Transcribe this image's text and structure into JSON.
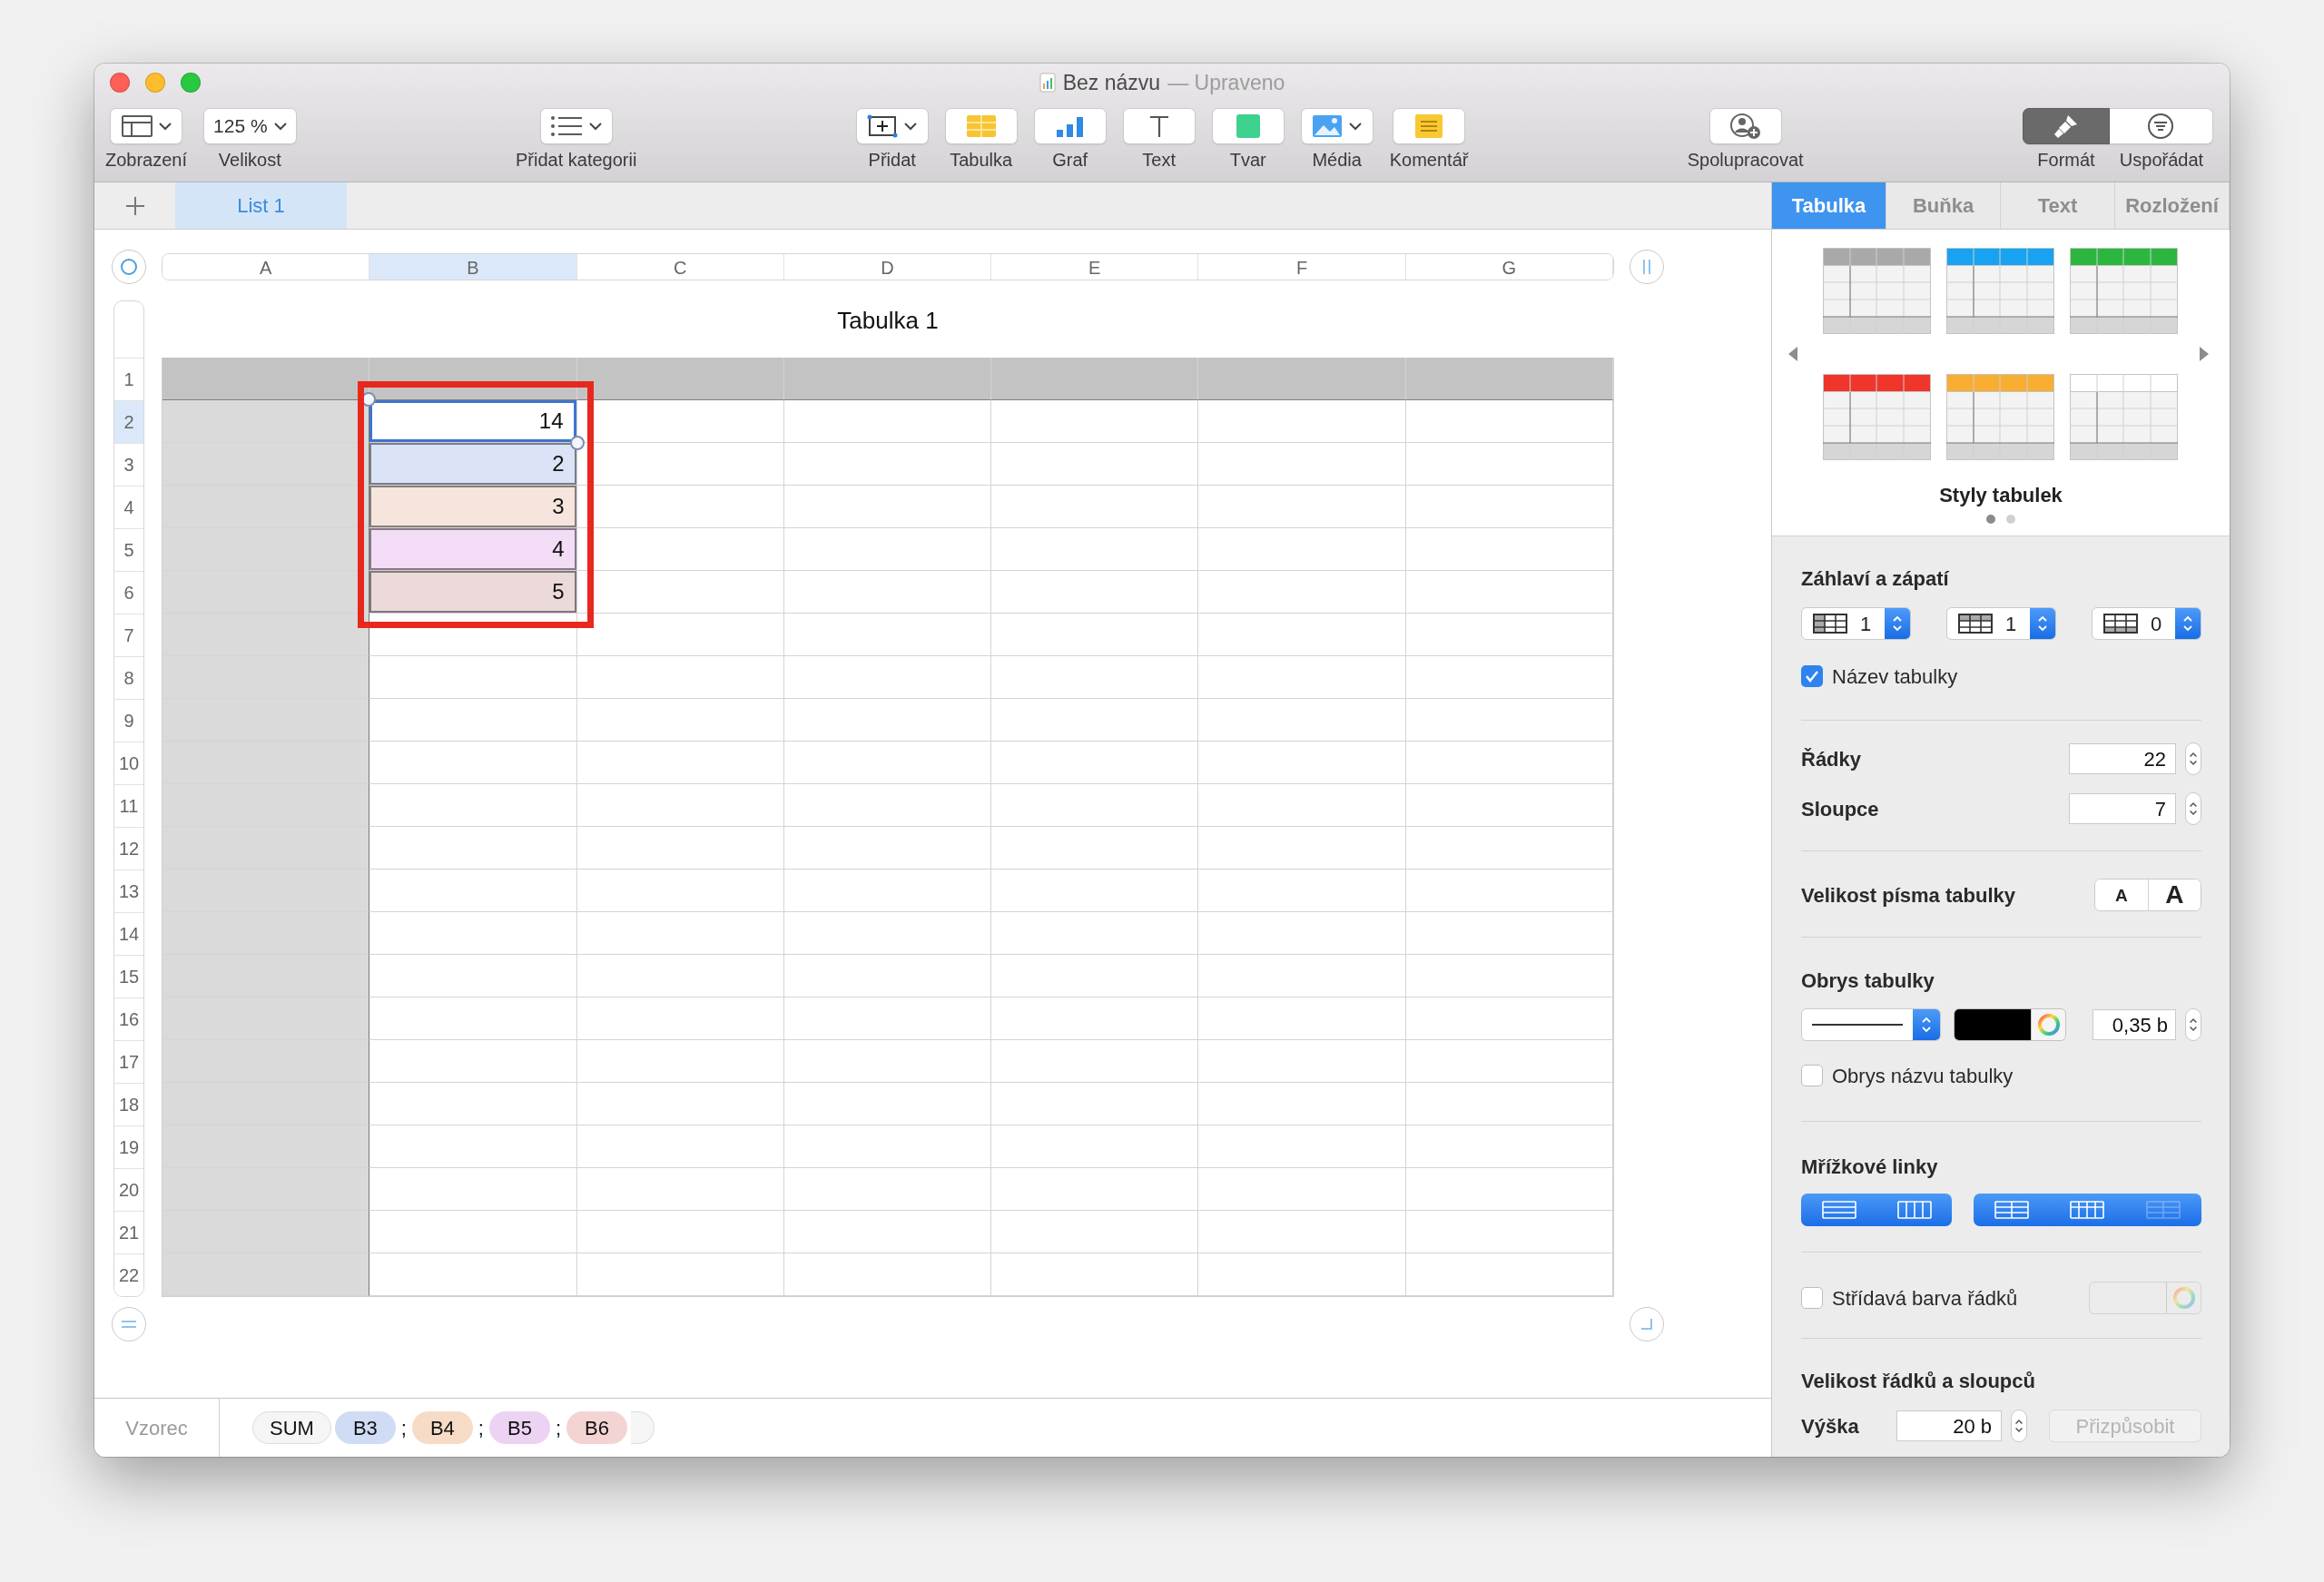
{
  "window": {
    "title": "Bez názvu",
    "status": "— Upraveno"
  },
  "toolbar": {
    "groups": [
      {
        "items": [
          {
            "kind": "view",
            "label": "Zobrazení",
            "dropdown": true
          },
          {
            "kind": "zoom",
            "label": "Velikost",
            "value": "125 %",
            "dropdown": true
          }
        ]
      },
      {
        "items": [
          {
            "kind": "category",
            "label": "Přidat kategorii",
            "dropdown": true
          }
        ]
      },
      {
        "items": [
          {
            "kind": "insert",
            "label": "Přidat",
            "dropdown": true
          },
          {
            "kind": "table",
            "label": "Tabulka",
            "dropdown": false
          },
          {
            "kind": "chart",
            "label": "Graf",
            "dropdown": false
          },
          {
            "kind": "text",
            "label": "Text",
            "dropdown": false
          },
          {
            "kind": "shape",
            "label": "Tvar",
            "dropdown": false
          },
          {
            "kind": "media",
            "label": "Média",
            "dropdown": true
          },
          {
            "kind": "comment",
            "label": "Komentář",
            "dropdown": false
          }
        ]
      },
      {
        "items": [
          {
            "kind": "collaborate",
            "label": "Spolupracovat",
            "dropdown": false
          }
        ]
      },
      {
        "items": [
          {
            "kind": "format",
            "label": "Formát",
            "selected": true
          },
          {
            "kind": "arrange",
            "label": "Uspořádat",
            "selected": false
          }
        ]
      }
    ]
  },
  "sheets": [
    {
      "label": "List 1",
      "selected": true
    }
  ],
  "inspector_tabs": [
    {
      "label": "Tabulka",
      "selected": true
    },
    {
      "label": "Buňka",
      "selected": false
    },
    {
      "label": "Text",
      "selected": false
    },
    {
      "label": "Rozložení",
      "selected": false
    }
  ],
  "sheet": {
    "title": "Tabulka 1",
    "columns": [
      {
        "label": "A",
        "selected": false
      },
      {
        "label": "B",
        "selected": true
      },
      {
        "label": "C",
        "selected": false
      },
      {
        "label": "D",
        "selected": false
      },
      {
        "label": "E",
        "selected": false
      },
      {
        "label": "F",
        "selected": false
      },
      {
        "label": "G",
        "selected": false
      }
    ],
    "rows": [
      {
        "label": "1",
        "selected": false
      },
      {
        "label": "2",
        "selected": true,
        "cells": [
          null,
          {
            "value": "14",
            "color": "#ffffff",
            "selected": true
          }
        ]
      },
      {
        "label": "3",
        "selected": false,
        "cells": [
          null,
          {
            "value": "2",
            "color": "#dbe4f6",
            "selected": false
          }
        ]
      },
      {
        "label": "4",
        "selected": false,
        "cells": [
          null,
          {
            "value": "3",
            "color": "#f5e5dc",
            "selected": false
          }
        ]
      },
      {
        "label": "5",
        "selected": false,
        "cells": [
          null,
          {
            "value": "4",
            "color": "#f3dcf5",
            "selected": false
          }
        ]
      },
      {
        "label": "6",
        "selected": false,
        "cells": [
          null,
          {
            "value": "5",
            "color": "#ecd9da",
            "selected": false
          }
        ]
      },
      {
        "label": "7",
        "selected": false
      },
      {
        "label": "8",
        "selected": false
      },
      {
        "label": "9",
        "selected": false
      },
      {
        "label": "10",
        "selected": false
      },
      {
        "label": "11",
        "selected": false
      },
      {
        "label": "12",
        "selected": false
      },
      {
        "label": "13",
        "selected": false
      },
      {
        "label": "14",
        "selected": false
      },
      {
        "label": "15",
        "selected": false
      },
      {
        "label": "16",
        "selected": false
      },
      {
        "label": "17",
        "selected": false
      },
      {
        "label": "18",
        "selected": false
      },
      {
        "label": "19",
        "selected": false
      },
      {
        "label": "20",
        "selected": false
      },
      {
        "label": "21",
        "selected": false
      },
      {
        "label": "22",
        "selected": false
      }
    ]
  },
  "formula_bar": {
    "label": "Vzorec",
    "tokens": [
      {
        "kind": "function",
        "text": "SUM"
      },
      {
        "kind": "ref",
        "text": "B3",
        "color": "#cfdcf4"
      },
      {
        "kind": "separator",
        "text": ";"
      },
      {
        "kind": "ref",
        "text": "B4",
        "color": "#f6dcc6"
      },
      {
        "kind": "separator",
        "text": ";"
      },
      {
        "kind": "ref",
        "text": "B5",
        "color": "#ecd2f3"
      },
      {
        "kind": "separator",
        "text": ";"
      },
      {
        "kind": "ref",
        "text": "B6",
        "color": "#f4d3d3"
      }
    ]
  },
  "inspector": {
    "table_styles": [
      {
        "color": "#a9a9a9"
      },
      {
        "color": "#17a3f2"
      },
      {
        "color": "#2cb63f"
      },
      {
        "color": "#f0352a"
      },
      {
        "color": "#f8ad33"
      },
      {
        "color": "#ffffff"
      }
    ],
    "style_caption": "Styly tabulek",
    "style_pages": [
      {
        "selected": true
      },
      {
        "selected": false
      }
    ],
    "headers": {
      "title": "Záhlaví a zápatí",
      "steppers": [
        {
          "kind": "header-rows",
          "value": "1"
        },
        {
          "kind": "header-columns",
          "value": "1"
        },
        {
          "kind": "footer-rows",
          "value": "0"
        }
      ],
      "table_name": {
        "label": "Název tabulky",
        "checked": true
      }
    },
    "rows": {
      "label": "Řádky",
      "value": "22"
    },
    "columns": {
      "label": "Sloupce",
      "value": "7"
    },
    "font_size": {
      "label": "Velikost písma tabulky",
      "buttons": [
        {
          "kind": "smaller",
          "label": "A"
        },
        {
          "kind": "larger",
          "label": "A"
        }
      ]
    },
    "outline": {
      "title": "Obrys tabulky",
      "color": "#000000",
      "width": "0,35 b",
      "title_outline": {
        "label": "Obrys názvu tabulky",
        "checked": false
      }
    },
    "gridlines": {
      "title": "Mřížkové linky",
      "groups": [
        [
          {
            "kind": "body-horizontal",
            "on": true
          },
          {
            "kind": "body-vertical",
            "on": true
          }
        ],
        [
          {
            "kind": "header-horizontal",
            "on": true
          },
          {
            "kind": "header-vertical",
            "on": true
          },
          {
            "kind": "footer",
            "on": false
          }
        ]
      ]
    },
    "alternating": {
      "label": "Střídavá barva řádků",
      "checked": false
    },
    "size": {
      "title": "Velikost řádků a sloupců",
      "height_label": "Výška",
      "height": "20 b",
      "fit": {
        "label": "Přizpůsobit",
        "disabled": true
      }
    }
  }
}
